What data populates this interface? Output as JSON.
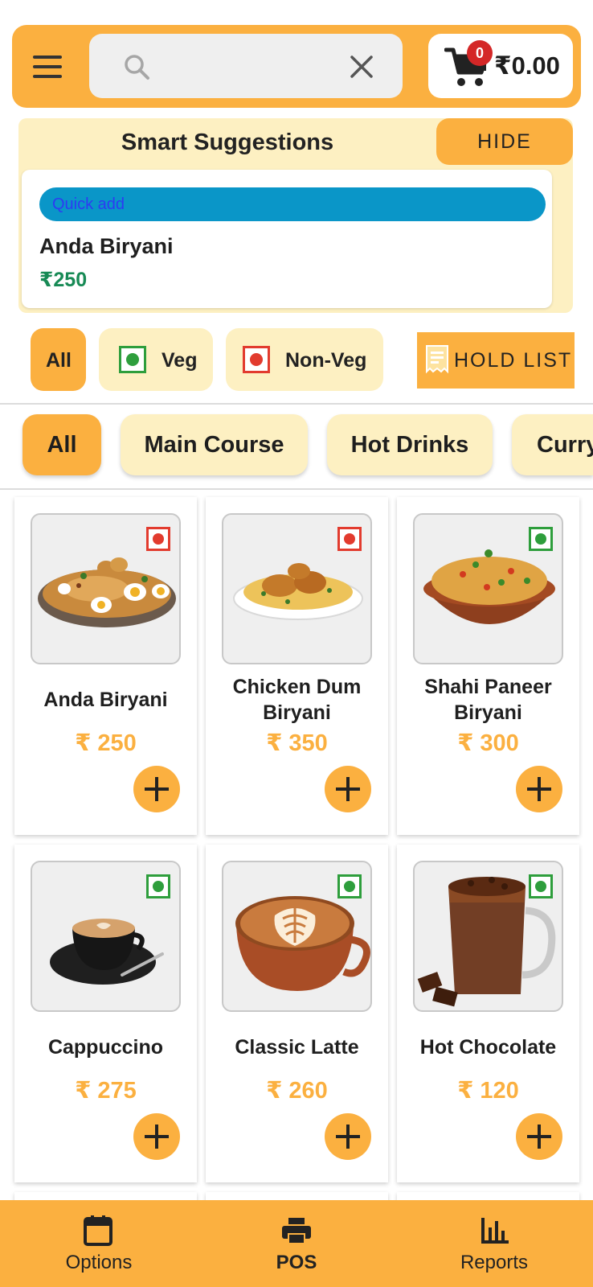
{
  "header": {
    "search_placeholder": "",
    "cart_badge": "0",
    "cart_total": "₹0.00"
  },
  "suggestions": {
    "title": "Smart Suggestions",
    "hide_label": "HIDE",
    "quick_add_label": "Quick add",
    "item_name": "Anda Biryani",
    "item_price": "₹250"
  },
  "diet_filters": [
    {
      "label": "All",
      "active": true
    },
    {
      "label": "Veg",
      "type": "veg"
    },
    {
      "label": "Non-Veg",
      "type": "nonveg"
    }
  ],
  "hold_list_label": "HOLD LIST",
  "categories": [
    {
      "label": "All",
      "active": true
    },
    {
      "label": "Main Course"
    },
    {
      "label": "Hot Drinks"
    },
    {
      "label": "Curry"
    }
  ],
  "products": [
    {
      "name": "Anda Biryani",
      "price": "₹ 250",
      "diet": "nonveg",
      "icon": "biryani-icon"
    },
    {
      "name": "Chicken Dum Biryani",
      "price": "₹ 350",
      "diet": "nonveg",
      "icon": "biryani-icon"
    },
    {
      "name": "Shahi Paneer Biryani",
      "price": "₹ 300",
      "diet": "veg",
      "icon": "biryani-icon"
    },
    {
      "name": "Cappuccino",
      "price": "₹ 275",
      "diet": "veg",
      "icon": "coffee-cup-icon"
    },
    {
      "name": "Classic Latte",
      "price": "₹ 260",
      "diet": "veg",
      "icon": "latte-icon"
    },
    {
      "name": "Hot Chocolate",
      "price": "₹ 120",
      "diet": "veg",
      "icon": "mug-icon"
    }
  ],
  "nav": [
    {
      "label": "Options",
      "icon": "calendar-icon"
    },
    {
      "label": "POS",
      "icon": "printer-icon",
      "active": true
    },
    {
      "label": "Reports",
      "icon": "bar-chart-icon"
    }
  ],
  "colors": {
    "accent": "#fbb040",
    "chip_bg": "#fdf0c2",
    "veg": "#2e9e3c",
    "nonveg": "#e23b2e",
    "quick_add": "#0a96c8"
  }
}
